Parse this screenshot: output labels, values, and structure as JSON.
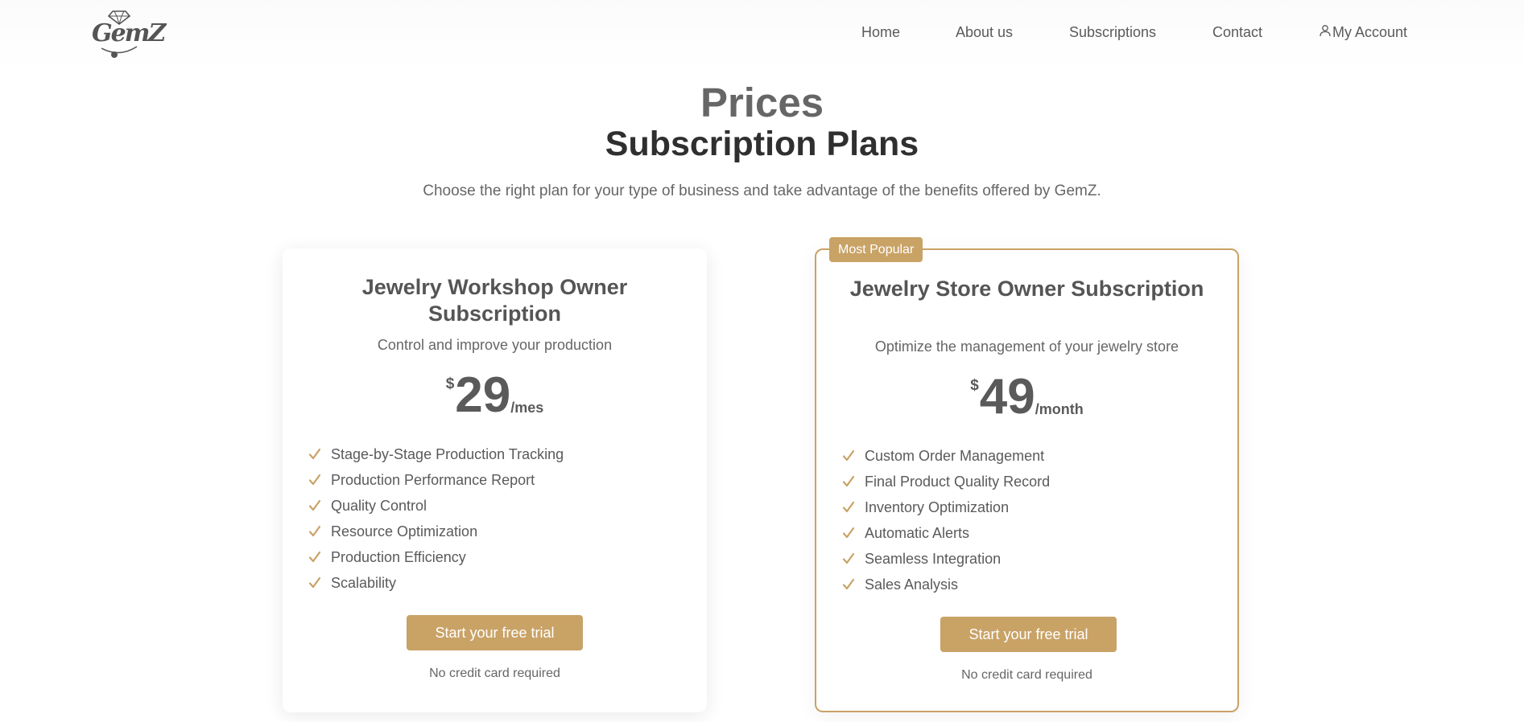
{
  "nav": {
    "logo_text": "GemZ",
    "items": [
      "Home",
      "About us",
      "Subscriptions",
      "Contact",
      "My Account"
    ]
  },
  "hero": {
    "eyebrow": "Prices",
    "title": "Subscription Plans",
    "subtitle": "Choose the right plan for your type of business and take advantage of the benefits offered by GemZ."
  },
  "plans": [
    {
      "title": "Jewelry Workshop Owner Subscription",
      "description": "Control and improve your production",
      "currency": "$",
      "amount": "29",
      "period": "/mes",
      "features": [
        "Stage-by-Stage Production Tracking",
        "Production Performance Report",
        "Quality Control",
        "Resource Optimization",
        "Production Efficiency",
        "Scalability"
      ],
      "cta": "Start your free trial",
      "note": "No credit card required"
    },
    {
      "badge": "Most Popular",
      "title": "Jewelry Store Owner Subscription",
      "description": "Optimize the management of your jewelry store",
      "currency": "$",
      "amount": "49",
      "period": "/month",
      "features": [
        "Custom Order Management",
        "Final Product Quality Record",
        "Inventory Optimization",
        "Automatic Alerts",
        "Seamless Integration",
        "Sales Analysis"
      ],
      "cta": "Start your free trial",
      "note": "No credit card required"
    }
  ],
  "colors": {
    "accent": "#c9a266",
    "heading": "#2f2f2f",
    "text": "#5f5f5f"
  },
  "icons": {
    "logo": "diamond-logo-icon",
    "account": "user-icon",
    "feature": "check-icon"
  }
}
